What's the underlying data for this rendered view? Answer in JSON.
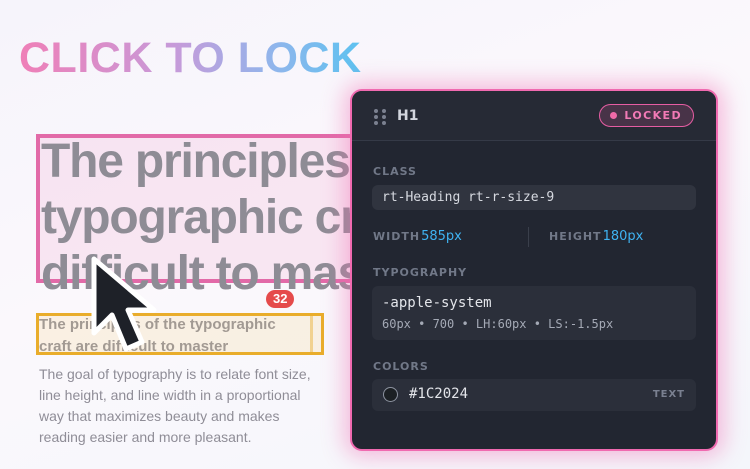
{
  "headline": "CLICK TO LOCK",
  "page": {
    "heading_lines": [
      "The principles of",
      "typographic craft is",
      "difficult to master"
    ],
    "subheading_lines": [
      "The principles of the typographic",
      "craft are difficult to master"
    ],
    "size_badge": "32",
    "body_lines": [
      "The goal of typography is to relate font size,",
      "line height, and line width in a proportional",
      "way that maximizes beauty and makes",
      "reading easier and more pleasant."
    ]
  },
  "inspector": {
    "tag": "H1",
    "status": "LOCKED",
    "class_label": "CLASS",
    "class_value": "rt-Heading rt-r-size-9",
    "width_label": "WIDTH",
    "width_value": "585px",
    "height_label": "HEIGHT",
    "height_value": "180px",
    "typography_label": "TYPOGRAPHY",
    "font_family": "-apple-system",
    "font_meta": "60px • 700 • LH:60px • LS:-1.5px",
    "colors_label": "COLORS",
    "color_hex": "#1C2024",
    "color_role": "TEXT",
    "swatch_color": "#1C2024"
  },
  "theme": {
    "accent_pink": "#F06AB0",
    "accent_blue": "#3FB3F2",
    "highlight_yellow": "#E9AD2B",
    "badge_red": "#E54B4B"
  },
  "icons": {
    "drag_handle": "grip-dots-icon",
    "cursor": "mouse-pointer-icon",
    "locked": "status-dot-icon"
  }
}
